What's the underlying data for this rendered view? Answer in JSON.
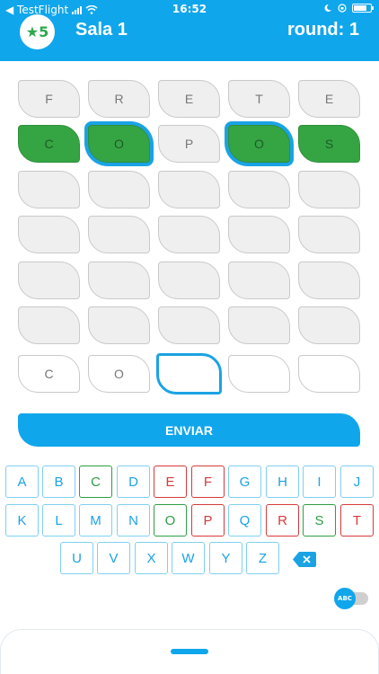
{
  "status_bar": {
    "carrier": "◀ TestFlight",
    "time": "16:52"
  },
  "header": {
    "star_badge": "★5",
    "room_title": "Sala 1",
    "round_label": "round: 1"
  },
  "board": {
    "rows": [
      [
        "F",
        "R",
        "E",
        "T",
        "E"
      ],
      [
        "C",
        "O",
        "P",
        "O",
        "S"
      ],
      [
        "",
        "",
        "",
        "",
        ""
      ],
      [
        "",
        "",
        "",
        "",
        ""
      ],
      [
        "",
        "",
        "",
        "",
        ""
      ],
      [
        "",
        "",
        "",
        "",
        ""
      ]
    ],
    "states": [
      [
        "gray",
        "gray",
        "gray",
        "gray",
        "gray"
      ],
      [
        "green",
        "green-outline",
        "gray",
        "green-outline",
        "green"
      ],
      [
        "gray",
        "gray",
        "gray",
        "gray",
        "gray"
      ],
      [
        "gray",
        "gray",
        "gray",
        "gray",
        "gray"
      ],
      [
        "gray",
        "gray",
        "gray",
        "gray",
        "gray"
      ],
      [
        "gray",
        "gray",
        "gray",
        "gray",
        "gray"
      ]
    ],
    "input_row": [
      "C",
      "O",
      "",
      "",
      ""
    ],
    "active_index": 2
  },
  "submit": {
    "label": "ENVIAR"
  },
  "keyboard": {
    "row1": [
      {
        "k": "A",
        "s": "blue"
      },
      {
        "k": "B",
        "s": "blue"
      },
      {
        "k": "C",
        "s": "green"
      },
      {
        "k": "D",
        "s": "blue"
      },
      {
        "k": "E",
        "s": "red"
      },
      {
        "k": "F",
        "s": "red"
      },
      {
        "k": "G",
        "s": "blue"
      },
      {
        "k": "H",
        "s": "blue"
      },
      {
        "k": "I",
        "s": "blue"
      },
      {
        "k": "J",
        "s": "blue"
      }
    ],
    "row2": [
      {
        "k": "K",
        "s": "blue"
      },
      {
        "k": "L",
        "s": "blue"
      },
      {
        "k": "M",
        "s": "blue"
      },
      {
        "k": "N",
        "s": "blue"
      },
      {
        "k": "O",
        "s": "green"
      },
      {
        "k": "P",
        "s": "red"
      },
      {
        "k": "Q",
        "s": "blue"
      },
      {
        "k": "R",
        "s": "red"
      },
      {
        "k": "S",
        "s": "green"
      },
      {
        "k": "T",
        "s": "red"
      }
    ],
    "row3": [
      {
        "k": "U",
        "s": "blue"
      },
      {
        "k": "V",
        "s": "blue"
      },
      {
        "k": "X",
        "s": "blue"
      },
      {
        "k": "W",
        "s": "blue"
      },
      {
        "k": "Y",
        "s": "blue"
      },
      {
        "k": "Z",
        "s": "blue"
      }
    ]
  },
  "toggle": {
    "label": "ABC"
  },
  "colors": {
    "accent": "#10a6ec",
    "green": "#35a544",
    "red": "#d63a3a"
  }
}
